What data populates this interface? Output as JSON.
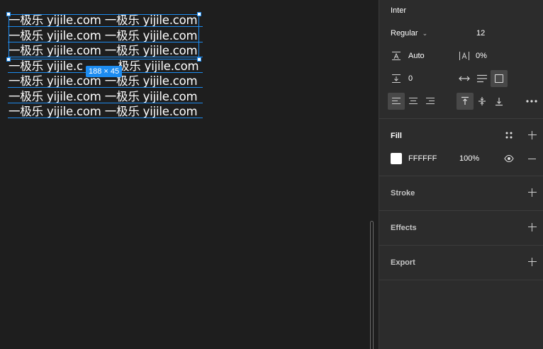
{
  "canvas": {
    "text_lines": [
      "一极乐 yijile.com 一极乐 yijile.com",
      "一极乐 yijile.com 一极乐 yijile.com",
      "一极乐 yijile.com 一极乐 yijile.com",
      "一极乐 yijile.c",
      "一极乐 yijile.com 一极乐 yijile.com",
      "一极乐 yijile.com 一极乐 yijile.com",
      "一极乐 yijile.com 一极乐 yijile.com"
    ],
    "line4_tail": "极乐 yijile.com",
    "size_badge": "188 × 45",
    "colors": {
      "selection": "#1d8cf0",
      "background": "#1e1e1e"
    }
  },
  "typography": {
    "font_family": "Inter",
    "font_weight": "Regular",
    "font_size": "12",
    "line_height": "Auto",
    "letter_spacing": "0%",
    "paragraph_spacing": "0",
    "icons": {
      "line_height": "line-height-icon",
      "letter_spacing": "letter-spacing-icon",
      "paragraph_spacing": "paragraph-spacing-icon",
      "auto_width": "auto-width-icon",
      "auto_height": "auto-height-icon",
      "fixed_size": "fixed-size-icon",
      "align_left": "align-left-icon",
      "align_center": "align-center-icon",
      "align_right": "align-right-icon",
      "align_top": "align-top-icon",
      "align_middle": "align-middle-icon",
      "align_bottom": "align-bottom-icon",
      "more": "more-options-icon"
    }
  },
  "fill": {
    "title": "Fill",
    "hex": "FFFFFF",
    "opacity": "100%",
    "swatch_color": "#ffffff"
  },
  "stroke": {
    "title": "Stroke"
  },
  "effects": {
    "title": "Effects"
  },
  "export": {
    "title": "Export"
  }
}
